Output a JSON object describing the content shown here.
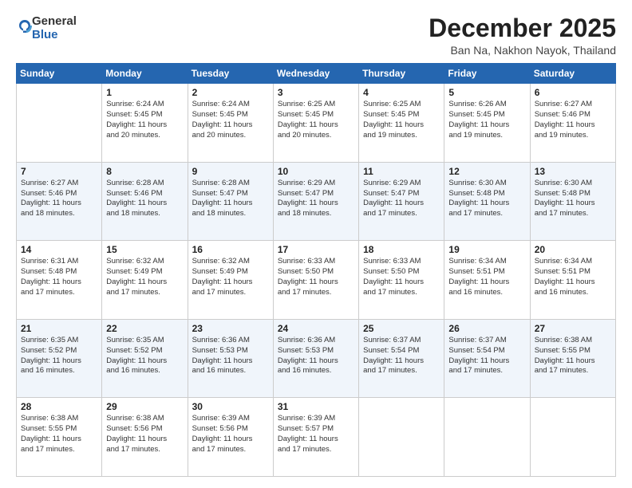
{
  "header": {
    "logo": {
      "general": "General",
      "blue": "Blue"
    },
    "title": "December 2025",
    "location": "Ban Na, Nakhon Nayok, Thailand"
  },
  "days_of_week": [
    "Sunday",
    "Monday",
    "Tuesday",
    "Wednesday",
    "Thursday",
    "Friday",
    "Saturday"
  ],
  "weeks": [
    [
      {
        "day": "",
        "info": ""
      },
      {
        "day": "1",
        "info": "Sunrise: 6:24 AM\nSunset: 5:45 PM\nDaylight: 11 hours\nand 20 minutes."
      },
      {
        "day": "2",
        "info": "Sunrise: 6:24 AM\nSunset: 5:45 PM\nDaylight: 11 hours\nand 20 minutes."
      },
      {
        "day": "3",
        "info": "Sunrise: 6:25 AM\nSunset: 5:45 PM\nDaylight: 11 hours\nand 20 minutes."
      },
      {
        "day": "4",
        "info": "Sunrise: 6:25 AM\nSunset: 5:45 PM\nDaylight: 11 hours\nand 19 minutes."
      },
      {
        "day": "5",
        "info": "Sunrise: 6:26 AM\nSunset: 5:45 PM\nDaylight: 11 hours\nand 19 minutes."
      },
      {
        "day": "6",
        "info": "Sunrise: 6:27 AM\nSunset: 5:46 PM\nDaylight: 11 hours\nand 19 minutes."
      }
    ],
    [
      {
        "day": "7",
        "info": "Sunrise: 6:27 AM\nSunset: 5:46 PM\nDaylight: 11 hours\nand 18 minutes."
      },
      {
        "day": "8",
        "info": "Sunrise: 6:28 AM\nSunset: 5:46 PM\nDaylight: 11 hours\nand 18 minutes."
      },
      {
        "day": "9",
        "info": "Sunrise: 6:28 AM\nSunset: 5:47 PM\nDaylight: 11 hours\nand 18 minutes."
      },
      {
        "day": "10",
        "info": "Sunrise: 6:29 AM\nSunset: 5:47 PM\nDaylight: 11 hours\nand 18 minutes."
      },
      {
        "day": "11",
        "info": "Sunrise: 6:29 AM\nSunset: 5:47 PM\nDaylight: 11 hours\nand 17 minutes."
      },
      {
        "day": "12",
        "info": "Sunrise: 6:30 AM\nSunset: 5:48 PM\nDaylight: 11 hours\nand 17 minutes."
      },
      {
        "day": "13",
        "info": "Sunrise: 6:30 AM\nSunset: 5:48 PM\nDaylight: 11 hours\nand 17 minutes."
      }
    ],
    [
      {
        "day": "14",
        "info": "Sunrise: 6:31 AM\nSunset: 5:48 PM\nDaylight: 11 hours\nand 17 minutes."
      },
      {
        "day": "15",
        "info": "Sunrise: 6:32 AM\nSunset: 5:49 PM\nDaylight: 11 hours\nand 17 minutes."
      },
      {
        "day": "16",
        "info": "Sunrise: 6:32 AM\nSunset: 5:49 PM\nDaylight: 11 hours\nand 17 minutes."
      },
      {
        "day": "17",
        "info": "Sunrise: 6:33 AM\nSunset: 5:50 PM\nDaylight: 11 hours\nand 17 minutes."
      },
      {
        "day": "18",
        "info": "Sunrise: 6:33 AM\nSunset: 5:50 PM\nDaylight: 11 hours\nand 17 minutes."
      },
      {
        "day": "19",
        "info": "Sunrise: 6:34 AM\nSunset: 5:51 PM\nDaylight: 11 hours\nand 16 minutes."
      },
      {
        "day": "20",
        "info": "Sunrise: 6:34 AM\nSunset: 5:51 PM\nDaylight: 11 hours\nand 16 minutes."
      }
    ],
    [
      {
        "day": "21",
        "info": "Sunrise: 6:35 AM\nSunset: 5:52 PM\nDaylight: 11 hours\nand 16 minutes."
      },
      {
        "day": "22",
        "info": "Sunrise: 6:35 AM\nSunset: 5:52 PM\nDaylight: 11 hours\nand 16 minutes."
      },
      {
        "day": "23",
        "info": "Sunrise: 6:36 AM\nSunset: 5:53 PM\nDaylight: 11 hours\nand 16 minutes."
      },
      {
        "day": "24",
        "info": "Sunrise: 6:36 AM\nSunset: 5:53 PM\nDaylight: 11 hours\nand 16 minutes."
      },
      {
        "day": "25",
        "info": "Sunrise: 6:37 AM\nSunset: 5:54 PM\nDaylight: 11 hours\nand 17 minutes."
      },
      {
        "day": "26",
        "info": "Sunrise: 6:37 AM\nSunset: 5:54 PM\nDaylight: 11 hours\nand 17 minutes."
      },
      {
        "day": "27",
        "info": "Sunrise: 6:38 AM\nSunset: 5:55 PM\nDaylight: 11 hours\nand 17 minutes."
      }
    ],
    [
      {
        "day": "28",
        "info": "Sunrise: 6:38 AM\nSunset: 5:55 PM\nDaylight: 11 hours\nand 17 minutes."
      },
      {
        "day": "29",
        "info": "Sunrise: 6:38 AM\nSunset: 5:56 PM\nDaylight: 11 hours\nand 17 minutes."
      },
      {
        "day": "30",
        "info": "Sunrise: 6:39 AM\nSunset: 5:56 PM\nDaylight: 11 hours\nand 17 minutes."
      },
      {
        "day": "31",
        "info": "Sunrise: 6:39 AM\nSunset: 5:57 PM\nDaylight: 11 hours\nand 17 minutes."
      },
      {
        "day": "",
        "info": ""
      },
      {
        "day": "",
        "info": ""
      },
      {
        "day": "",
        "info": ""
      }
    ]
  ]
}
